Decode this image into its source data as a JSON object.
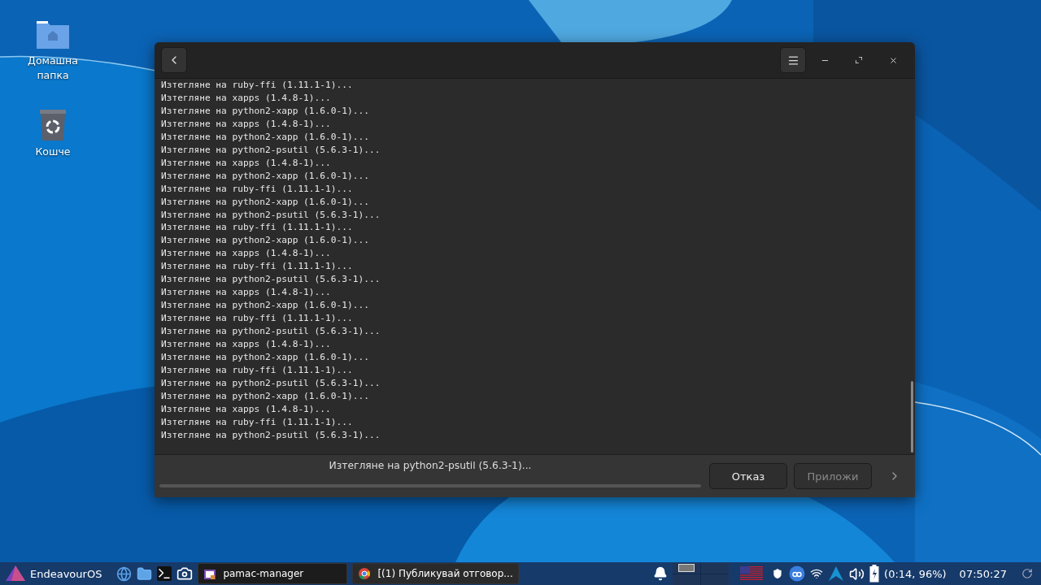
{
  "desktop_icons": [
    {
      "kind": "folder",
      "label": "Домашна папка"
    },
    {
      "kind": "trash",
      "label": "Кошче"
    }
  ],
  "window": {
    "log": [
      "Изтегляне на ruby-ffi (1.11.1-1)...",
      "Изтегляне на xapps (1.4.8-1)...",
      "Изтегляне на python2-xapp (1.6.0-1)...",
      "Изтегляне на xapps (1.4.8-1)...",
      "Изтегляне на python2-xapp (1.6.0-1)...",
      "Изтегляне на python2-psutil (5.6.3-1)...",
      "Изтегляне на xapps (1.4.8-1)...",
      "Изтегляне на python2-xapp (1.6.0-1)...",
      "Изтегляне на ruby-ffi (1.11.1-1)...",
      "Изтегляне на python2-xapp (1.6.0-1)...",
      "Изтегляне на python2-psutil (5.6.3-1)...",
      "Изтегляне на ruby-ffi (1.11.1-1)...",
      "Изтегляне на python2-xapp (1.6.0-1)...",
      "Изтегляне на xapps (1.4.8-1)...",
      "Изтегляне на ruby-ffi (1.11.1-1)...",
      "Изтегляне на python2-psutil (5.6.3-1)...",
      "Изтегляне на xapps (1.4.8-1)...",
      "Изтегляне на python2-xapp (1.6.0-1)...",
      "Изтегляне на ruby-ffi (1.11.1-1)...",
      "Изтегляне на python2-psutil (5.6.3-1)...",
      "Изтегляне на xapps (1.4.8-1)...",
      "Изтегляне на python2-xapp (1.6.0-1)...",
      "Изтегляне на ruby-ffi (1.11.1-1)...",
      "Изтегляне на python2-psutil (5.6.3-1)...",
      "Изтегляне на python2-xapp (1.6.0-1)...",
      "Изтегляне на xapps (1.4.8-1)...",
      "Изтегляне на ruby-ffi (1.11.1-1)...",
      "Изтегляне на python2-psutil (5.6.3-1)..."
    ],
    "status": "Изтегляне на python2-psutil (5.6.3-1)...",
    "buttons": [
      {
        "label": "Отказ",
        "disabled": false
      },
      {
        "label": "Приложи",
        "disabled": true
      }
    ]
  },
  "taskbar": {
    "menu": "EndeavourOS",
    "tasks": [
      {
        "kind": "pamac",
        "label": "pamac-manager",
        "selected": true
      },
      {
        "kind": "browser",
        "label": "[(1) Публикувай отговор...",
        "selected": false
      }
    ],
    "battery": "(0:14, 96%)",
    "clock": "07:50:27"
  }
}
